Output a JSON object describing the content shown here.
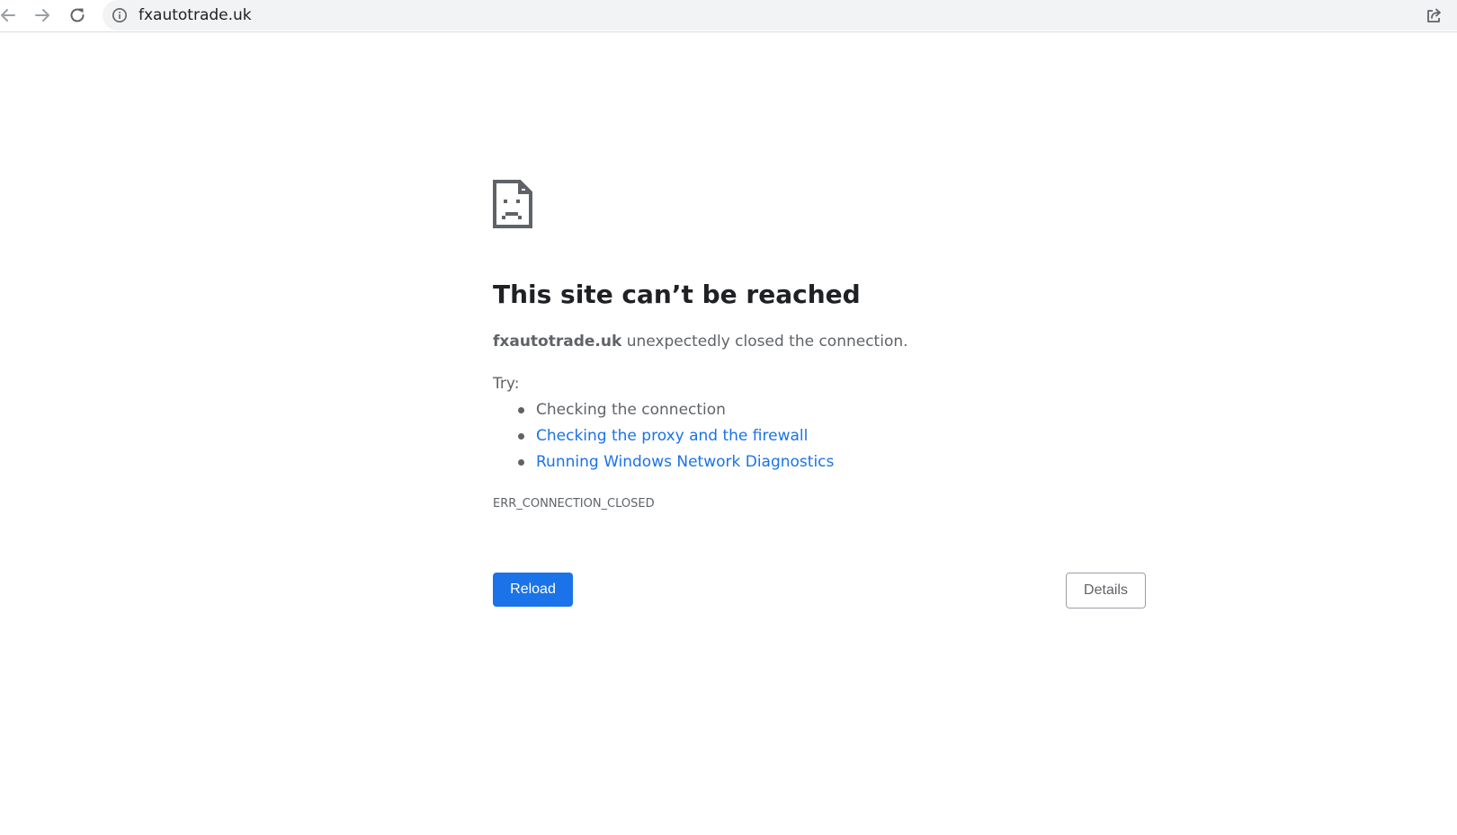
{
  "browser": {
    "url": "fxautotrade.uk",
    "icons": {
      "back": "arrow-left-icon",
      "forward": "arrow-right-icon",
      "reload": "reload-icon",
      "site_info": "info-circle-icon",
      "share": "share-icon"
    }
  },
  "error_page": {
    "icon": "sad-page-icon",
    "title": "This site can’t be reached",
    "host": "fxautotrade.uk",
    "message": " unexpectedly closed the connection.",
    "try_label": "Try:",
    "suggestions": [
      {
        "text": "Checking the connection",
        "is_link": false
      },
      {
        "text": "Checking the proxy and the firewall",
        "is_link": true
      },
      {
        "text": "Running Windows Network Diagnostics",
        "is_link": true
      }
    ],
    "error_code": "ERR_CONNECTION_CLOSED",
    "reload_label": "Reload",
    "details_label": "Details"
  },
  "colors": {
    "accent": "#1a73e8",
    "text_primary": "#202124",
    "text_secondary": "#5f6368",
    "omnibox_bg": "#f1f3f4"
  }
}
